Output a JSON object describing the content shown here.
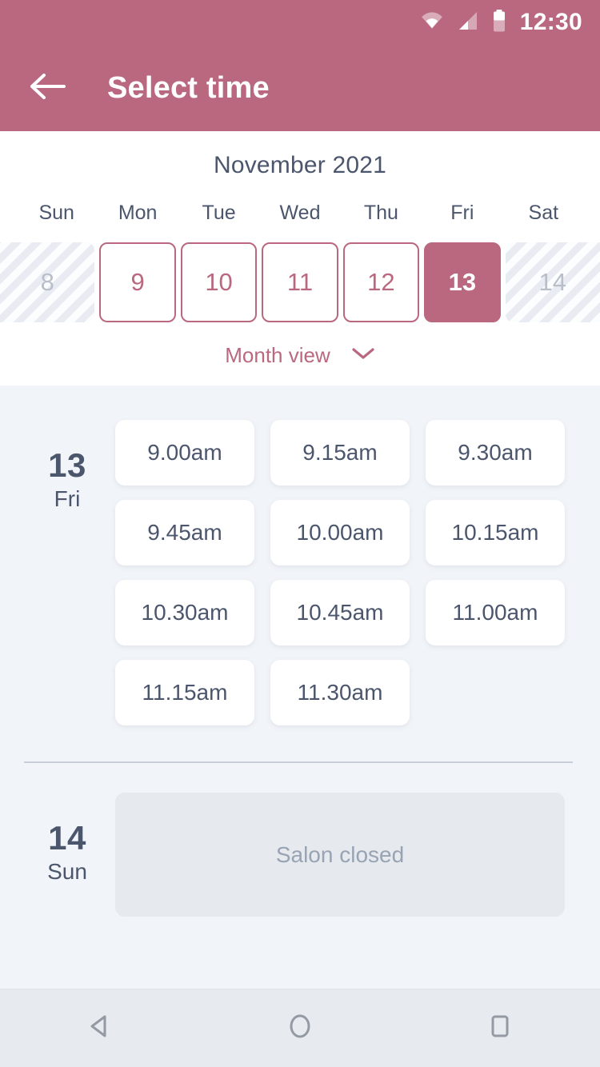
{
  "status_bar": {
    "time": "12:30",
    "icons": [
      "wifi-icon",
      "cellular-signal-icon",
      "battery-icon"
    ]
  },
  "app_bar": {
    "back_icon": "arrow-left-icon",
    "title": "Select time"
  },
  "calendar": {
    "month_title": "November 2021",
    "weekdays": [
      "Sun",
      "Mon",
      "Tue",
      "Wed",
      "Thu",
      "Fri",
      "Sat"
    ],
    "days": [
      {
        "num": "8",
        "state": "disabled"
      },
      {
        "num": "9",
        "state": "available"
      },
      {
        "num": "10",
        "state": "available"
      },
      {
        "num": "11",
        "state": "available"
      },
      {
        "num": "12",
        "state": "available"
      },
      {
        "num": "13",
        "state": "selected"
      },
      {
        "num": "14",
        "state": "disabled"
      }
    ],
    "month_view_label": "Month view",
    "month_view_icon": "chevron-down-icon"
  },
  "day_groups": [
    {
      "day_num": "13",
      "day_of_week": "Fri",
      "slots": [
        "9.00am",
        "9.15am",
        "9.30am",
        "9.45am",
        "10.00am",
        "10.15am",
        "10.30am",
        "10.45am",
        "11.00am",
        "11.15am",
        "11.30am"
      ]
    },
    {
      "day_num": "14",
      "day_of_week": "Sun",
      "closed_message": "Salon closed"
    }
  ],
  "nav_bar": {
    "back_icon": "android-back-icon",
    "home_icon": "android-home-icon",
    "recents_icon": "android-recents-icon"
  },
  "colors": {
    "brand": "#b9687f",
    "body_bg": "#f1f4f8",
    "text_dark": "#4b566d",
    "muted": "#98a3b4",
    "closed_bg": "#e6e9ed"
  }
}
